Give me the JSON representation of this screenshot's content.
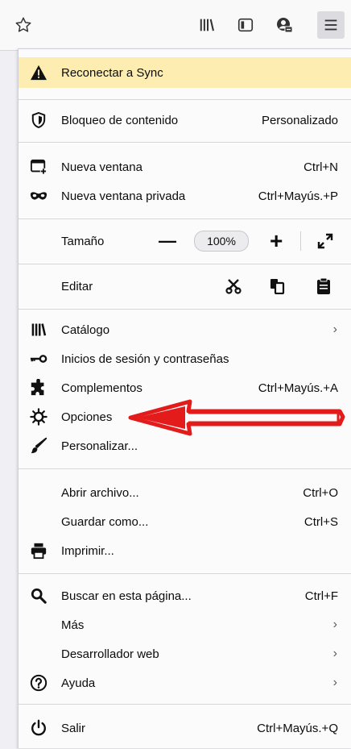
{
  "toolbar": {
    "icons": [
      "star-icon",
      "library-icon",
      "sidebar-icon",
      "account-icon",
      "hamburger-menu-icon"
    ]
  },
  "menu": {
    "sync": {
      "label": "Reconectar a Sync"
    },
    "content_blocking": {
      "label": "Bloqueo de contenido",
      "value": "Personalizado"
    },
    "new_window": {
      "label": "Nueva ventana",
      "shortcut": "Ctrl+N"
    },
    "new_private_window": {
      "label": "Nueva ventana privada",
      "shortcut": "Ctrl+Mayús.+P"
    },
    "zoom": {
      "label": "Tamaño",
      "minus": "—",
      "value": "100%",
      "plus": "+"
    },
    "edit": {
      "label": "Editar"
    },
    "library": {
      "label": "Catálogo",
      "arrow": "›"
    },
    "logins": {
      "label": "Inicios de sesión y contraseñas"
    },
    "addons": {
      "label": "Complementos",
      "shortcut": "Ctrl+Mayús.+A"
    },
    "options": {
      "label": "Opciones"
    },
    "customize": {
      "label": "Personalizar..."
    },
    "open_file": {
      "label": "Abrir archivo...",
      "shortcut": "Ctrl+O"
    },
    "save_as": {
      "label": "Guardar como...",
      "shortcut": "Ctrl+S"
    },
    "print": {
      "label": "Imprimir..."
    },
    "find": {
      "label": "Buscar en esta página...",
      "shortcut": "Ctrl+F"
    },
    "more": {
      "label": "Más",
      "arrow": "›"
    },
    "web_developer": {
      "label": "Desarrollador web",
      "arrow": "›"
    },
    "help": {
      "label": "Ayuda",
      "arrow": "›"
    },
    "quit": {
      "label": "Salir",
      "shortcut": "Ctrl+Mayús.+Q"
    }
  },
  "colors": {
    "sync_bg": "#fdedb0",
    "annotation_arrow": "#e31b1b"
  }
}
